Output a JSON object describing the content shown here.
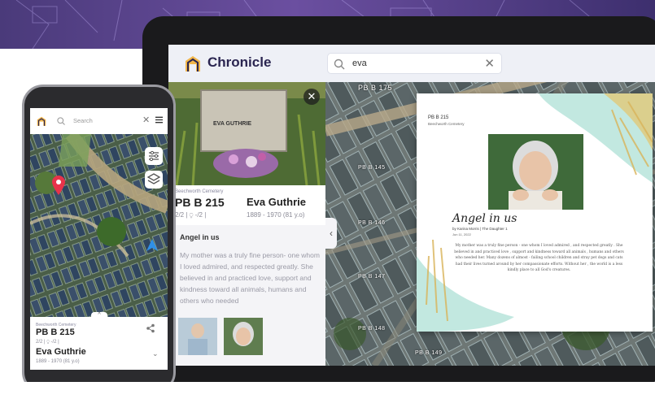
{
  "tablet": {
    "brand": "Chronicle",
    "search_value": "eva",
    "clear_symbol": "✕",
    "close_symbol": "✕",
    "collapse_symbol": "‹",
    "plot_labels": [
      "PB B 175",
      "PB B 145",
      "PB B 146",
      "PB B 147",
      "PB B 148",
      "PB B 149"
    ],
    "cemetery": "Beechworth Cemetery",
    "plot_id": "PB B 215",
    "person_name": "Eva Guthrie",
    "counts": "2/2 | ⍜ -/2 |",
    "years": "1889 - 1970 (81 y.o)",
    "story_title": "Angel in us",
    "story_text": "My mother was a truly fine person- one whom I loved admired, and respected greatly. She believed in and practiced love, support and kindness toward all animals, humans and others who needed",
    "headstone_text": [
      "EVA GUTHRIE"
    ]
  },
  "card": {
    "plot": "PB B 215",
    "cemetery": "Beechworth Cemetery",
    "title": "Angel in us",
    "byline": "by Karina Morris | The Daughter 1",
    "date": "Jun 11, 2022",
    "text": "My mother was a truly fine person - one whom I loved admired , and respected greatly . She believed in and practiced love , support and kindness toward all animals , humans and others who needed her. Many dozens of almost - failing school children and stray pet dogs and cats had their lives turned around by her compassionate efforts. Without her , the world is a less kindly place to all God's creatures."
  },
  "phone": {
    "search_placeholder": "Search",
    "clear_symbol": "✕",
    "handle_symbol": "^",
    "cemetery": "Beechworth Cemetery",
    "plot_id": "PB B 215",
    "counts": "2/2 | ⍜ -/2 |",
    "person_name": "Eva Guthrie",
    "years": "1889 - 1970 (81 y.o)",
    "chevron": "⌄"
  },
  "colors": {
    "brand": "#2a2550",
    "accent": "#f2b64a",
    "pin": "#e8334a",
    "locate": "#2f8fe8"
  },
  "icons": [
    "chronicle-logo-icon",
    "search-icon",
    "close-icon",
    "filter-sliders-icon",
    "layers-icon",
    "share-icon",
    "menu-icon",
    "map-pin-icon",
    "locate-arrow-icon",
    "chevron-down-icon"
  ]
}
